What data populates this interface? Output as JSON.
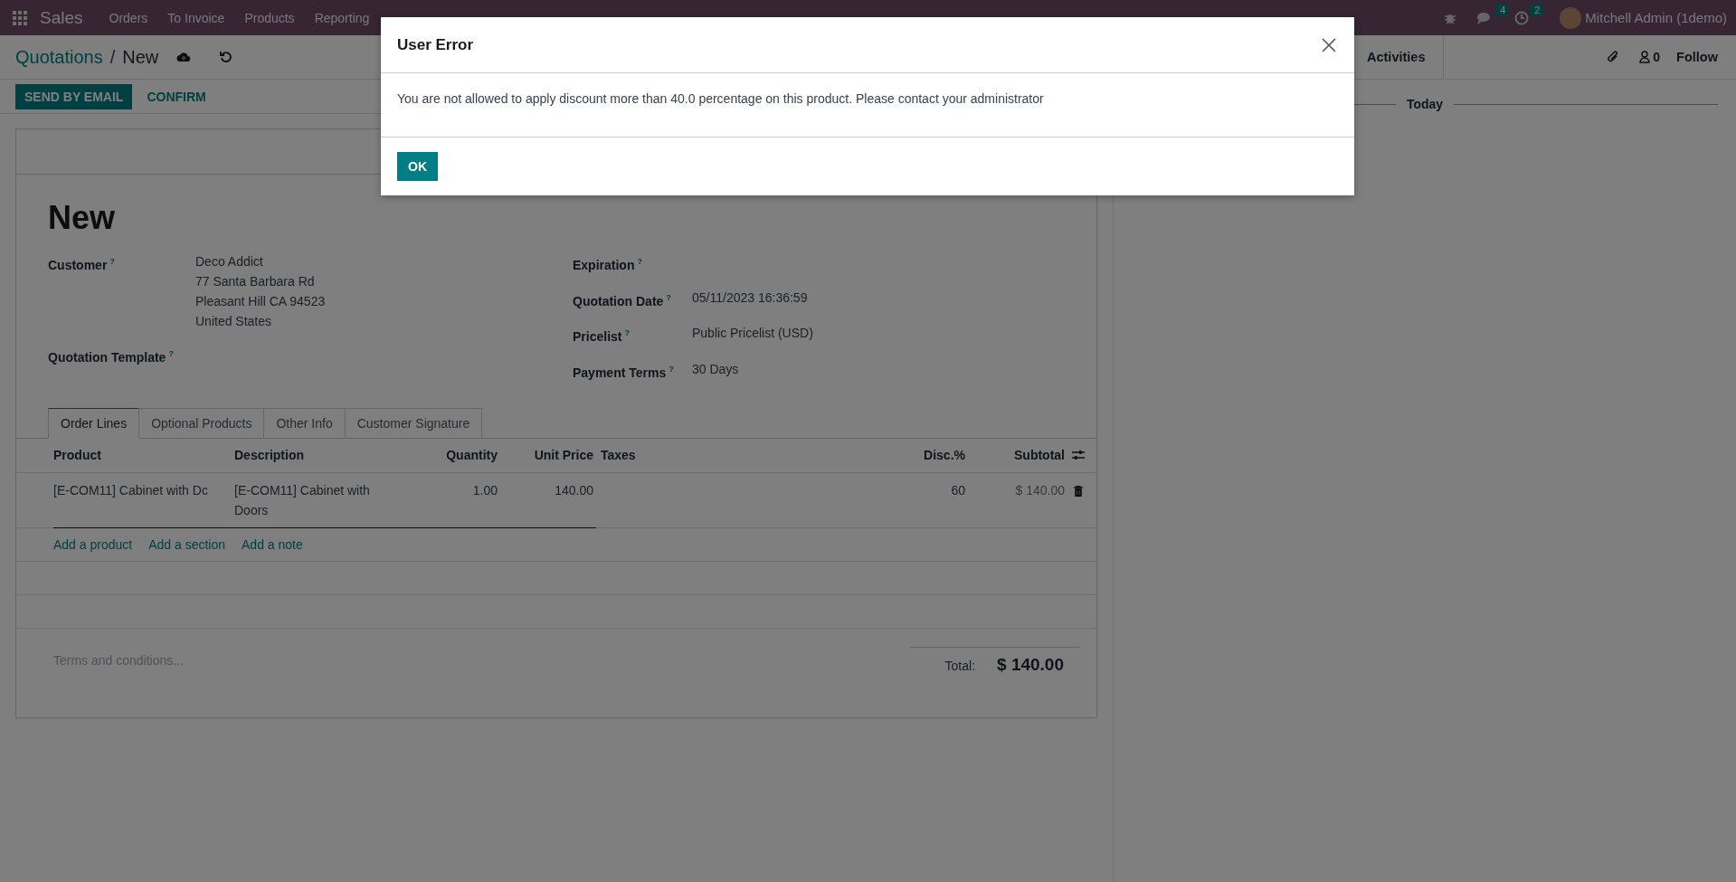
{
  "navbar": {
    "app_name": "Sales",
    "menu": [
      "Orders",
      "To Invoice",
      "Products",
      "Reporting"
    ],
    "messages_count": "4",
    "activities_count": "2",
    "user": "Mitchell Admin (1demo)"
  },
  "control_panel": {
    "breadcrumb": {
      "parent": "Quotations",
      "separator": "/",
      "current": "New"
    },
    "actions": [
      {
        "label": "SEND BY EMAIL",
        "kind": "primary"
      },
      {
        "label": "CONFIRM",
        "kind": "secondary"
      }
    ]
  },
  "form": {
    "title": "New",
    "left_fields": [
      {
        "label": "Customer",
        "help": "?",
        "lines": [
          "Deco Addict",
          "77 Santa Barbara Rd",
          "Pleasant Hill CA 94523",
          "United States"
        ]
      },
      {
        "label": "Quotation Template",
        "help": "?"
      }
    ],
    "right_fields": [
      {
        "label": "Expiration",
        "help": "?"
      },
      {
        "label": "Quotation Date",
        "help": "?",
        "lines": [
          "05/11/2023 16:36:59"
        ]
      },
      {
        "label": "Pricelist",
        "help": "?",
        "lines": [
          "Public Pricelist (USD)"
        ]
      },
      {
        "label": "Payment Terms",
        "help": "?",
        "lines": [
          "30 Days"
        ]
      }
    ],
    "tabs": [
      {
        "label": "Order Lines",
        "selected": true
      },
      {
        "label": "Optional Products",
        "selected": false
      },
      {
        "label": "Other Info",
        "selected": false
      },
      {
        "label": "Customer Signature",
        "selected": false
      }
    ],
    "table": {
      "columns": [
        "Product",
        "Description",
        "Quantity",
        "Unit Price",
        "Taxes",
        "Disc.%",
        "Subtotal"
      ],
      "rows": [
        {
          "product": "[E-COM11] Cabinet with Dc",
          "description": "[E-COM11] Cabinet with Doors",
          "quantity": "1.00",
          "unit_price": "140.00",
          "discount": "60",
          "subtotal": "$ 140.00"
        }
      ],
      "add_links": [
        "Add a product",
        "Add a section",
        "Add a note"
      ]
    },
    "terms": {
      "placeholder": "Terms and conditions..."
    },
    "total": {
      "label": "Total:",
      "value": "$ 140.00"
    }
  },
  "chatter": {
    "activities": "Activities",
    "followers_count": "0",
    "follow": "Follow",
    "date_separator": "Today"
  },
  "dialog": {
    "title": "User Error",
    "message": "You are not allowed to apply discount more than 40.0 percentage on this product. Please contact your administrator",
    "button": "OK"
  }
}
